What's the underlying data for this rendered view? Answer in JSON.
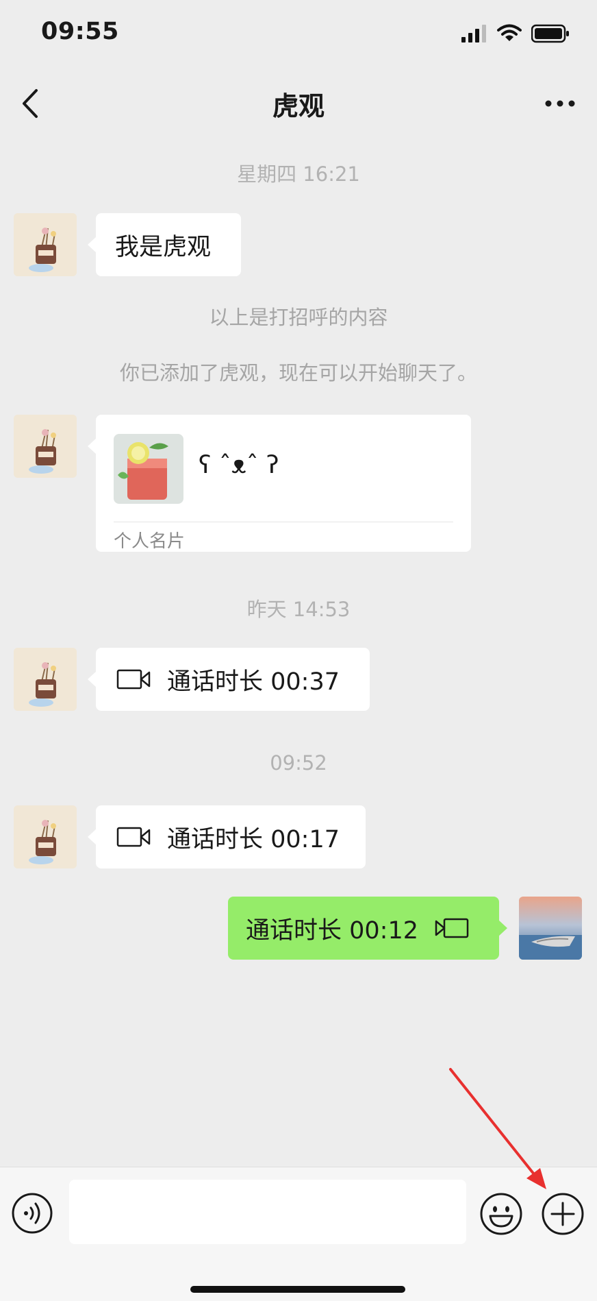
{
  "status_bar": {
    "time": "09:55"
  },
  "nav": {
    "title": "虎观"
  },
  "messages": {
    "ts1": "星期四 16:21",
    "msg1": "我是虎观",
    "system1": "以上是打招呼的内容",
    "system2": "你已添加了虎观，现在可以开始聊天了。",
    "card": {
      "name": "ʕ ˆᴥˆ ʔ",
      "type": "个人名片"
    },
    "ts2": "昨天 14:53",
    "call1": "通话时长 00:37",
    "ts3": "09:52",
    "call2": "通话时长 00:17",
    "call3": "通话时长 00:12"
  },
  "colors": {
    "background": "#ededed",
    "bubble_self": "#95ec69",
    "bubble_other": "#ffffff",
    "annotation_arrow": "#e8302f"
  },
  "icons": {
    "back": "chevron-left-icon",
    "more": "more-dots-icon",
    "voice": "voice-icon",
    "emoji": "emoji-icon",
    "plus": "plus-circle-icon",
    "call": "video-call-icon"
  }
}
